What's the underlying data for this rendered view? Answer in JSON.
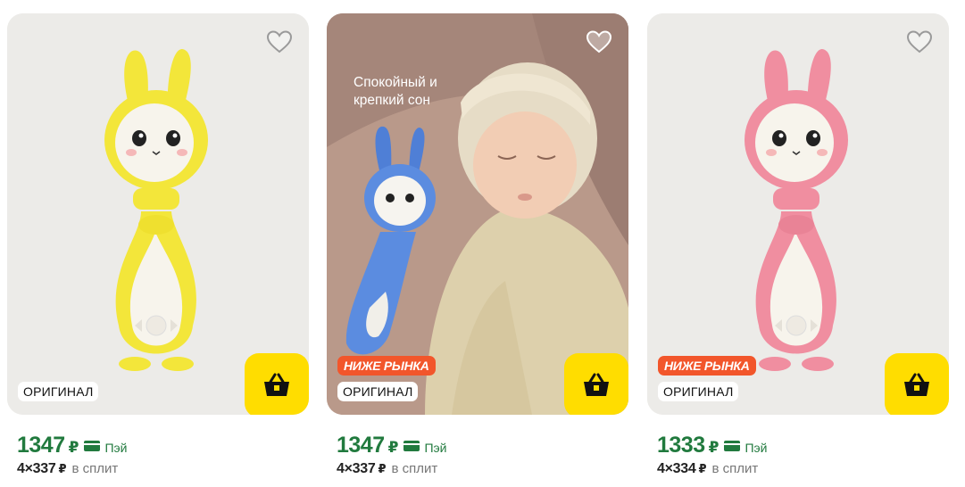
{
  "products": [
    {
      "promo_text": "",
      "badge_market": "",
      "badge_original": "ОРИГИНАЛ",
      "price": "1347",
      "currency": "₽",
      "pay_label": "Пэй",
      "split_count": "4",
      "split_amount": "337",
      "split_label": "в сплит",
      "toy_color": "yellow"
    },
    {
      "promo_text": "Спокойный и крепкий сон",
      "badge_market": "НИЖЕ РЫНКА",
      "badge_original": "ОРИГИНАЛ",
      "price": "1347",
      "currency": "₽",
      "pay_label": "Пэй",
      "split_count": "4",
      "split_amount": "337",
      "split_label": "в сплит",
      "toy_color": "blue"
    },
    {
      "promo_text": "",
      "badge_market": "НИЖЕ РЫНКА",
      "badge_original": "ОРИГИНАЛ",
      "price": "1333",
      "currency": "₽",
      "pay_label": "Пэй",
      "split_count": "4",
      "split_amount": "334",
      "split_label": "в сплит",
      "toy_color": "pink"
    }
  ],
  "colors": {
    "price_green": "#217a3e",
    "cart_yellow": "#ffdd00",
    "badge_orange": "#f2562b"
  },
  "icons": [
    "heart-icon",
    "basket-icon",
    "pay-card-icon"
  ]
}
